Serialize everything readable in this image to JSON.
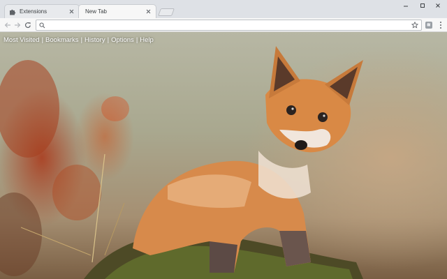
{
  "tabs": [
    {
      "title": "Extensions",
      "icon": "puzzle-icon",
      "active": false
    },
    {
      "title": "New Tab",
      "active": true
    }
  ],
  "toolbar": {
    "address_value": "",
    "address_placeholder": ""
  },
  "page_nav": {
    "links": [
      "Most Visited",
      "Bookmarks",
      "History",
      "Options",
      "Help"
    ],
    "separator": "|"
  },
  "background": {
    "subject": "fox-cub",
    "colors": {
      "fur": "#d78a4b",
      "moss": "#5f6a2c",
      "foliage": "#b84422"
    }
  }
}
